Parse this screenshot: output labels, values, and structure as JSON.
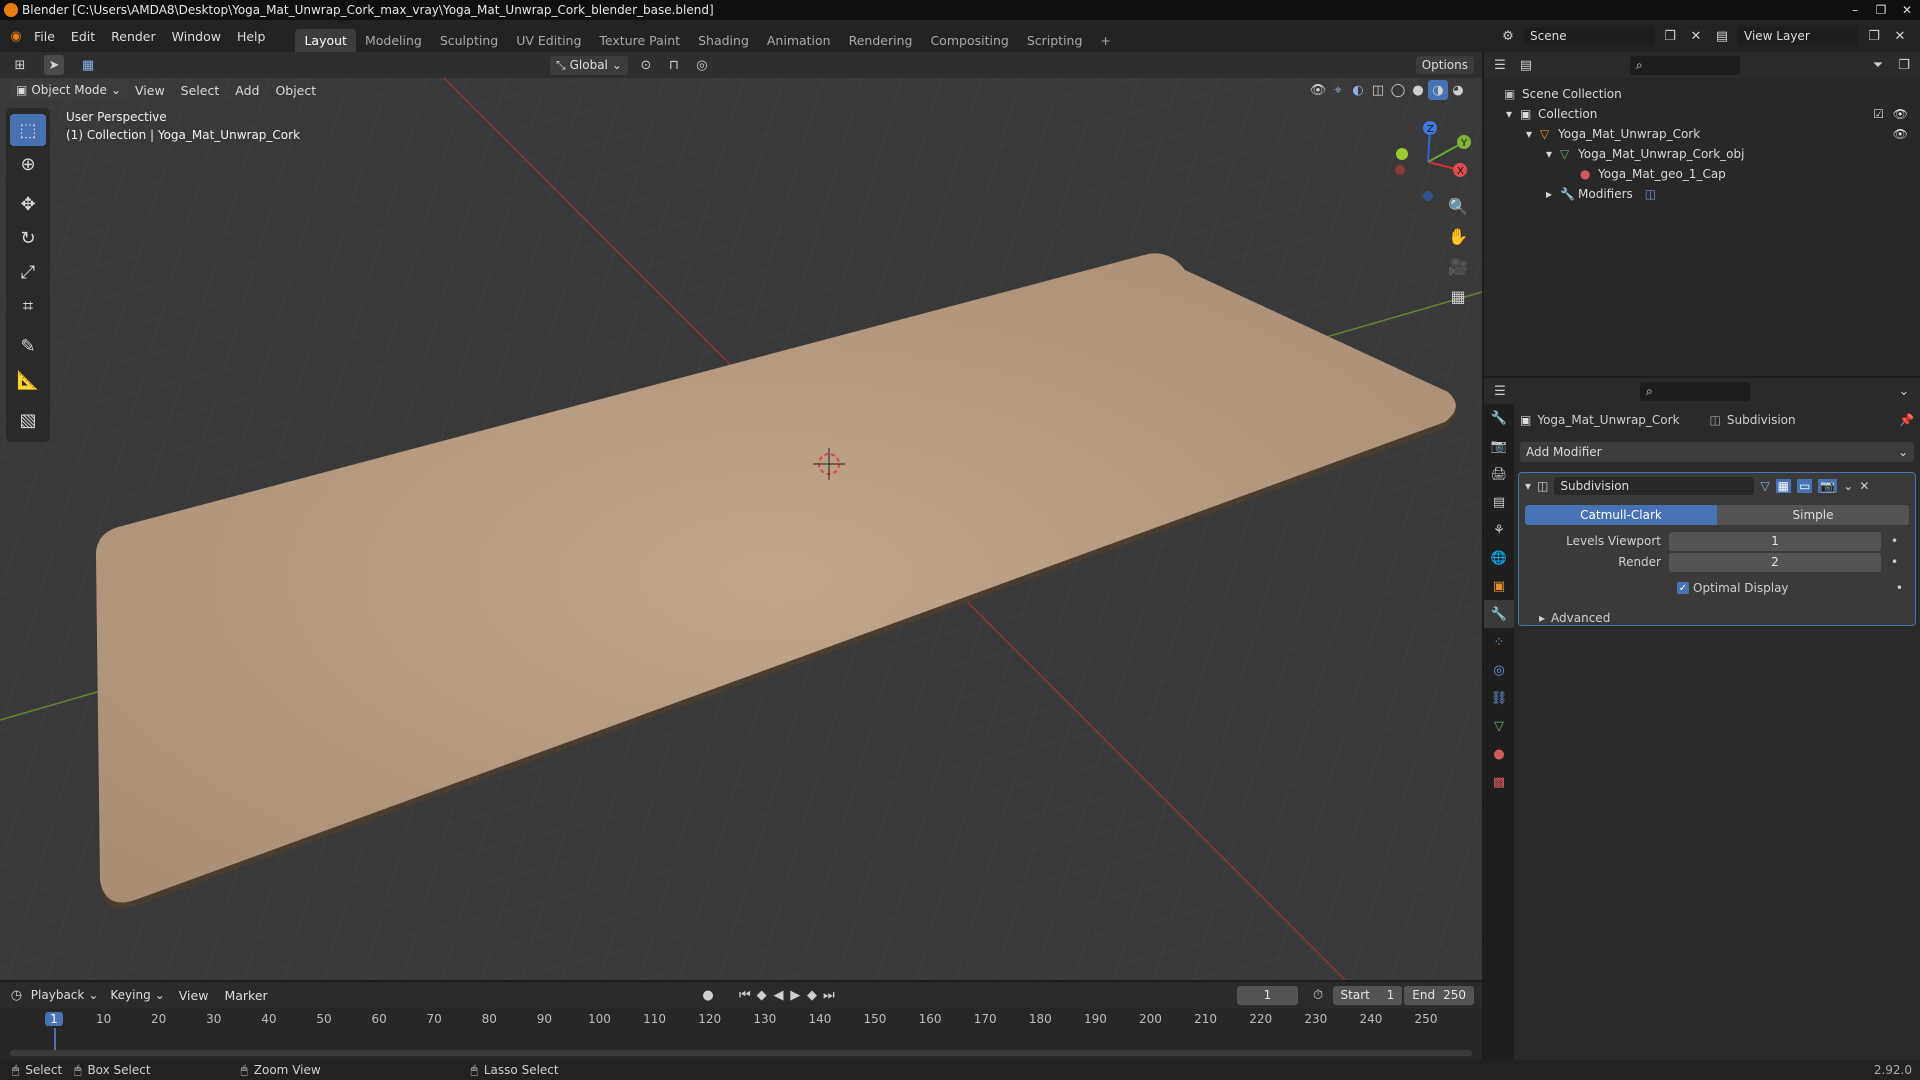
{
  "window": {
    "title": "Blender [C:\\Users\\AMDA8\\Desktop\\Yoga_Mat_Unwrap_Cork_max_vray\\Yoga_Mat_Unwrap_Cork_blender_base.blend]",
    "buttons": [
      "–",
      "❐",
      "✕"
    ]
  },
  "menu": [
    "File",
    "Edit",
    "Render",
    "Window",
    "Help"
  ],
  "workspaces": [
    "Layout",
    "Modeling",
    "Sculpting",
    "UV Editing",
    "Texture Paint",
    "Shading",
    "Animation",
    "Rendering",
    "Compositing",
    "Scripting"
  ],
  "add_workspace": "+",
  "scene": {
    "name": "Scene",
    "view_layer": "View Layer"
  },
  "tool_header": {
    "transform": "Global",
    "options": "Options"
  },
  "viewport_header": {
    "mode": "Object Mode",
    "menus": [
      "View",
      "Select",
      "Add",
      "Object"
    ]
  },
  "overlay": {
    "line1": "User Perspective",
    "line2": "(1) Collection | Yoga_Mat_Unwrap_Cork"
  },
  "gizmo": {
    "x": "X",
    "y": "Y",
    "z": "Z"
  },
  "outliner": {
    "scene_collection": "Scene Collection",
    "collection": "Collection",
    "object": "Yoga_Mat_Unwrap_Cork",
    "mesh": "Yoga_Mat_Unwrap_Cork_obj",
    "material": "Yoga_Mat_geo_1_Cap",
    "modifiers": "Modifiers"
  },
  "properties": {
    "object": "Yoga_Mat_Unwrap_Cork",
    "modifier_crumb": "Subdivision",
    "add_modifier": "Add Modifier",
    "modifier_name": "Subdivision",
    "catmull": "Catmull-Clark",
    "simple": "Simple",
    "levels_label": "Levels Viewport",
    "levels_value": "1",
    "render_label": "Render",
    "render_value": "2",
    "optimal": "Optimal Display",
    "advanced": "Advanced"
  },
  "timeline": {
    "menus": [
      "Playback",
      "Keying",
      "View",
      "Marker"
    ],
    "current_frame": "1",
    "start_label": "Start",
    "start": "1",
    "end_label": "End",
    "end": "250",
    "ticks": [
      "1",
      "10",
      "20",
      "30",
      "40",
      "50",
      "60",
      "70",
      "80",
      "90",
      "100",
      "110",
      "120",
      "130",
      "140",
      "150",
      "160",
      "170",
      "180",
      "190",
      "200",
      "210",
      "220",
      "230",
      "240",
      "250"
    ]
  },
  "status": {
    "select": "Select",
    "box": "Box Select",
    "zoom": "Zoom View",
    "lasso": "Lasso Select",
    "version": "2.92.0"
  }
}
